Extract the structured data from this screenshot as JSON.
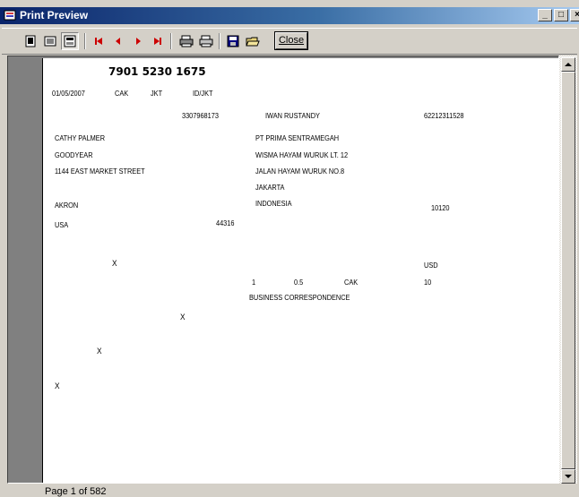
{
  "window": {
    "title": "Print Preview",
    "buttons": [
      "_",
      "□",
      "×"
    ]
  },
  "toolbar": {
    "icons": [
      "one-page-icon",
      "two-page-icon",
      "page-width-icon",
      "first-page-icon",
      "previous-page-icon",
      "next-page-icon",
      "last-page-icon",
      "print-setup-icon",
      "print-icon",
      "save-icon",
      "open-icon"
    ],
    "close_label": "Close"
  },
  "document": {
    "awb_number": "7901 5230 1675",
    "ship_date": "01/05/2007",
    "origin": "CAK",
    "destination": "JKT",
    "route": "ID/JKT",
    "account_number": "3307968173",
    "recipient_name": "IWAN RUSTANDY",
    "recipient_phone": "62212311528",
    "sender": {
      "name": "CATHY PALMER",
      "company": "GOODYEAR",
      "address": "1144 EAST MARKET STREET",
      "city": "AKRON",
      "country": "USA",
      "postal": "44316"
    },
    "recipient": {
      "company": "PT PRIMA SENTRAMEGAH",
      "address1": "WISMA HAYAM WURUK LT. 12",
      "address2": "JALAN HAYAM WURUK NO.8",
      "city": "JAKARTA",
      "country": "INDONESIA",
      "postal": "10120"
    },
    "currency": "USD",
    "pieces": "1",
    "weight": "0.5",
    "weight_origin": "CAK",
    "value": "10",
    "description": "BUSINESS CORRESPONDENCE",
    "mark": "X"
  },
  "status": {
    "page_text": "Page 1 of 582"
  }
}
